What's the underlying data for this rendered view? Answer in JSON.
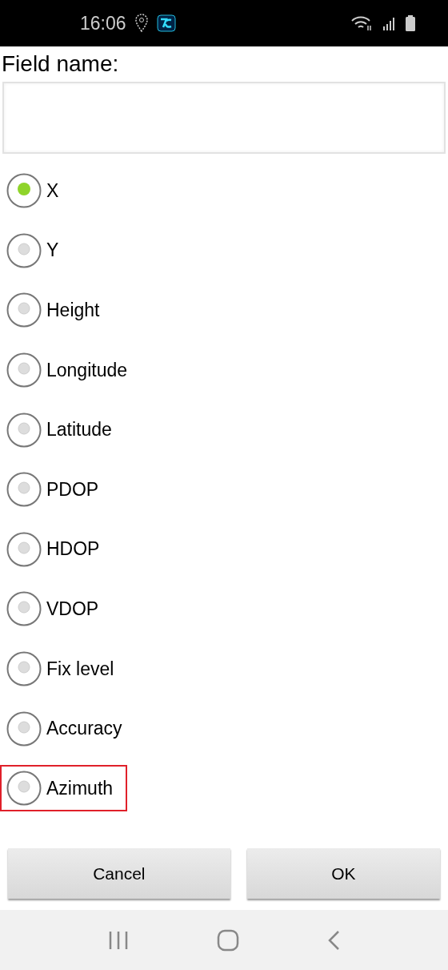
{
  "status_bar": {
    "time": "16:06"
  },
  "field": {
    "label": "Field name:"
  },
  "options": [
    {
      "label": "X",
      "selected": true,
      "highlighted": false
    },
    {
      "label": "Y",
      "selected": false,
      "highlighted": false
    },
    {
      "label": "Height",
      "selected": false,
      "highlighted": false
    },
    {
      "label": "Longitude",
      "selected": false,
      "highlighted": false
    },
    {
      "label": "Latitude",
      "selected": false,
      "highlighted": false
    },
    {
      "label": "PDOP",
      "selected": false,
      "highlighted": false
    },
    {
      "label": "HDOP",
      "selected": false,
      "highlighted": false
    },
    {
      "label": "VDOP",
      "selected": false,
      "highlighted": false
    },
    {
      "label": "Fix level",
      "selected": false,
      "highlighted": false
    },
    {
      "label": "Accuracy",
      "selected": false,
      "highlighted": false
    },
    {
      "label": "Azimuth",
      "selected": false,
      "highlighted": true
    }
  ],
  "buttons": [
    "Cancel",
    "OK"
  ]
}
